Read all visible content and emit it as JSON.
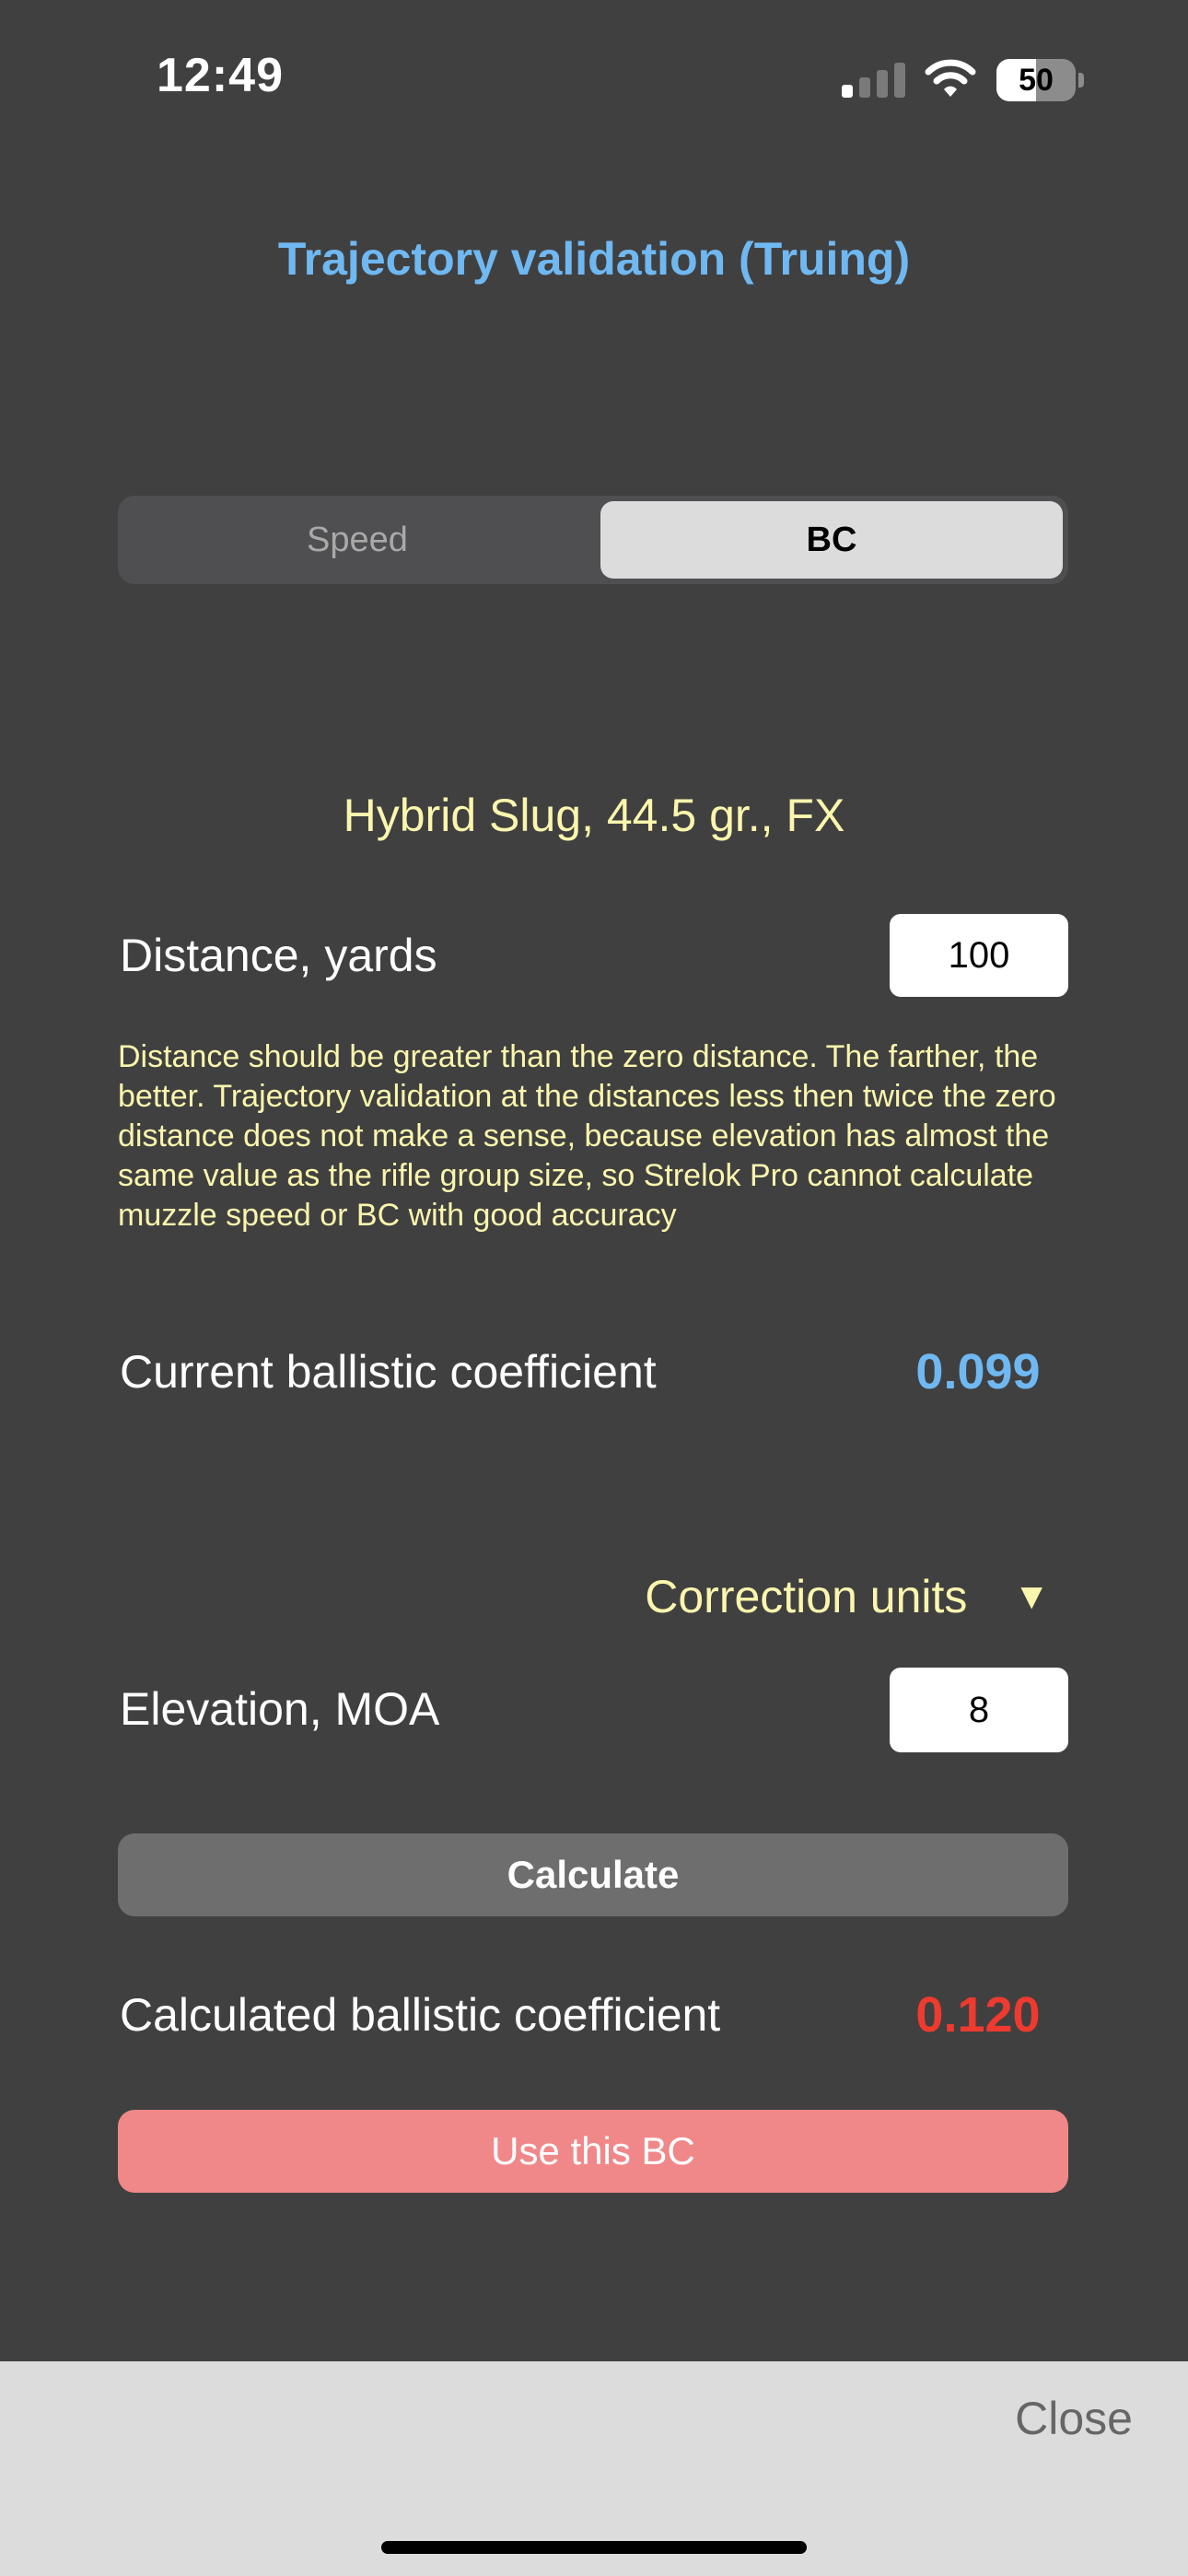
{
  "status_bar": {
    "time": "12:49",
    "battery": "50",
    "battery_level": 0.5,
    "signal_bars": 1,
    "icons": [
      "signal-icon",
      "wifi-icon",
      "battery-icon"
    ]
  },
  "header": {
    "title": "Trajectory validation (Truing)"
  },
  "segmented": {
    "options": [
      "Speed",
      "BC"
    ],
    "selected": "BC"
  },
  "ammo": {
    "name": "Hybrid Slug, 44.5 gr., FX"
  },
  "distance": {
    "label": "Distance, yards",
    "value": "100"
  },
  "hint": "Distance should be greater than the zero distance. The farther, the better. Trajectory validation at the distances less then twice the zero distance does not make a sense, because elevation has almost the same value as the rifle group size, so Strelok Pro cannot calculate muzzle speed or BC with good accuracy",
  "current_bc": {
    "label": "Current ballistic coefficient",
    "value": "0.099"
  },
  "correction_units": {
    "label": "Correction units",
    "arrow": "▼"
  },
  "elevation": {
    "label": "Elevation, MOA",
    "value": "8"
  },
  "buttons": {
    "calculate": "Calculate",
    "use_bc": "Use this BC",
    "close": "Close"
  },
  "calculated_bc": {
    "label": "Calculated ballistic coefficient",
    "value": "0.120"
  },
  "colors": {
    "background": "#404040",
    "title_blue": "#6fb8f2",
    "yellow_text": "#fbf6ad",
    "result_red": "#ee3a2f",
    "use_button": "#f0888a",
    "calculate_button": "#6e6e6e",
    "bottom_bar": "#dcdcdc"
  }
}
